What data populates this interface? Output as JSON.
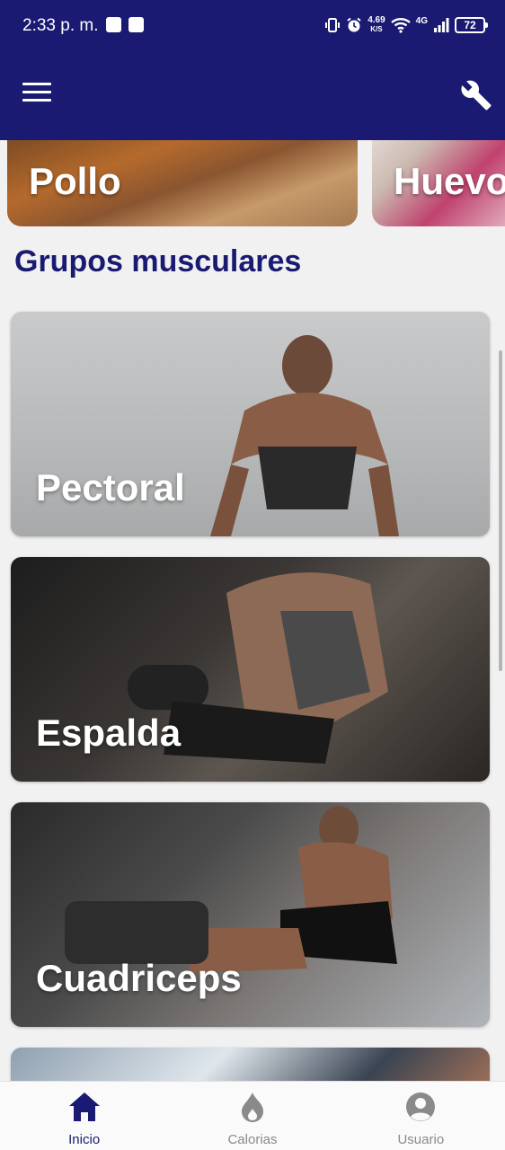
{
  "status_bar": {
    "time": "2:33 p. m.",
    "speed_value": "4.69",
    "speed_unit": "K/S",
    "network": "4G",
    "battery": "72"
  },
  "app_bar": {
    "menu_icon": "hamburger-menu-icon",
    "settings_icon": "wrench-icon",
    "color": "#1a1a72"
  },
  "food_carousel": {
    "items": [
      {
        "label": "Pollo"
      },
      {
        "label": "Huevo"
      }
    ]
  },
  "section": {
    "title": "Grupos musculares"
  },
  "muscle_groups": [
    {
      "label": "Pectoral"
    },
    {
      "label": "Espalda"
    },
    {
      "label": "Cuadriceps"
    }
  ],
  "bottom_nav": {
    "items": [
      {
        "label": "Inicio",
        "icon": "home-icon",
        "active": true
      },
      {
        "label": "Calorias",
        "icon": "flame-icon",
        "active": false
      },
      {
        "label": "Usuario",
        "icon": "user-icon",
        "active": false
      }
    ],
    "active_color": "#1a1a72",
    "inactive_color": "#8a8a8a"
  }
}
